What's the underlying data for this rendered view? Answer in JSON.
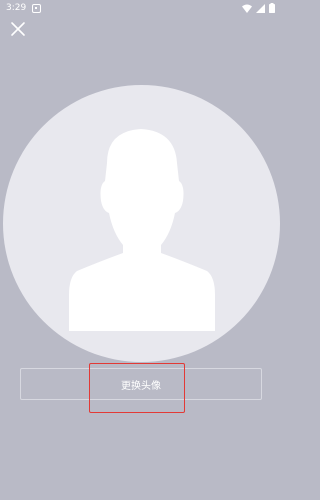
{
  "status_bar": {
    "time": "3:29",
    "notification_icon": "notification-icon",
    "wifi_icon": "wifi-icon",
    "signal_icon": "cellular-signal-icon",
    "battery_icon": "battery-icon"
  },
  "header": {
    "close_icon": "close-icon"
  },
  "avatar": {
    "placeholder_icon": "default-avatar-silhouette-icon"
  },
  "actions": {
    "change_avatar_label": "更换头像"
  },
  "colors": {
    "background": "#b9bac6",
    "avatar_bg": "#e8e8ee",
    "highlight": "#e23a36",
    "text": "#ffffff"
  }
}
